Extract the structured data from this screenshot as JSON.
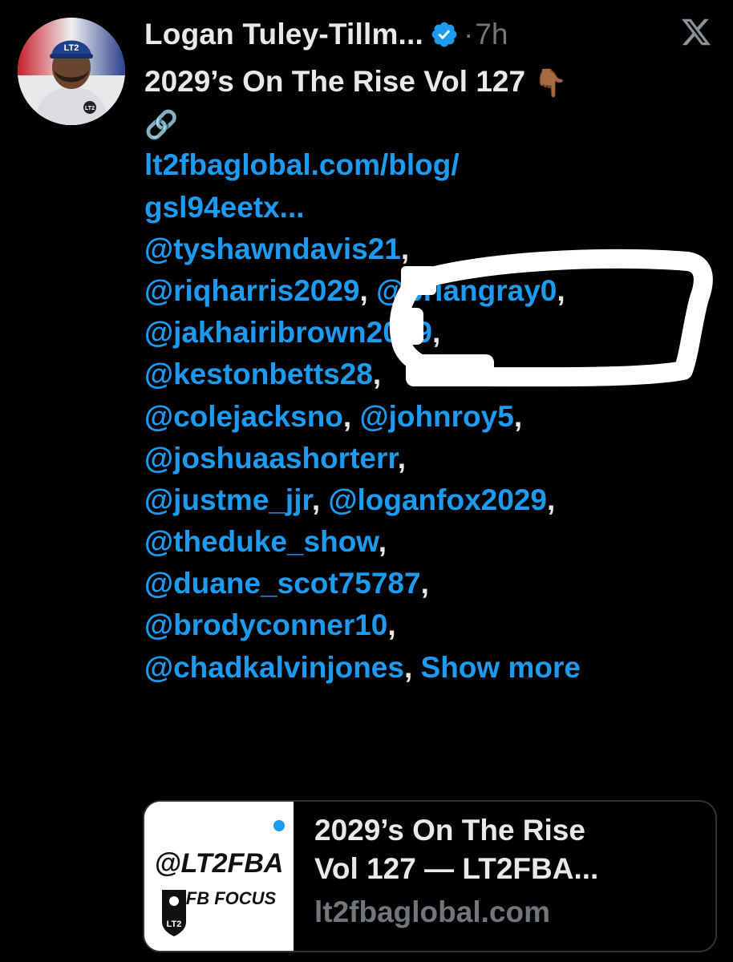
{
  "tweet": {
    "author": "Logan Tuley-Tillm...",
    "separator": "·",
    "time": "7h",
    "lines": [
      {
        "parts": [
          {
            "text": "2029’s On The Rise Vol 127 ",
            "kind": "plain"
          },
          {
            "text": "👇🏾",
            "kind": "emoji"
          }
        ]
      },
      {
        "parts": [
          {
            "text": "🔗",
            "kind": "emoji"
          }
        ]
      },
      {
        "parts": [
          {
            "text": "lt2fbaglobal.com/blog/",
            "kind": "link"
          }
        ]
      },
      {
        "parts": [
          {
            "text": "gsl94eetx...",
            "kind": "link"
          }
        ]
      },
      {
        "parts": [
          {
            "text": "@tyshawndavis21",
            "kind": "link"
          },
          {
            "text": ",",
            "kind": "plain"
          }
        ]
      },
      {
        "parts": [
          {
            "text": "@riqharris2029",
            "kind": "link"
          },
          {
            "text": ", ",
            "kind": "plain"
          },
          {
            "text": "@briangray0",
            "kind": "link"
          },
          {
            "text": ",",
            "kind": "plain"
          }
        ]
      },
      {
        "parts": [
          {
            "text": "@jakhairibrown2029",
            "kind": "link"
          },
          {
            "text": ",",
            "kind": "plain"
          }
        ]
      },
      {
        "parts": [
          {
            "text": "@kestonbetts28",
            "kind": "link"
          },
          {
            "text": ",",
            "kind": "plain"
          }
        ]
      },
      {
        "parts": [
          {
            "text": "@colejacksno",
            "kind": "link"
          },
          {
            "text": ", ",
            "kind": "plain"
          },
          {
            "text": "@johnroy5",
            "kind": "link"
          },
          {
            "text": ",",
            "kind": "plain"
          }
        ]
      },
      {
        "parts": [
          {
            "text": "@joshuaashorterr",
            "kind": "link"
          },
          {
            "text": ",",
            "kind": "plain"
          }
        ]
      },
      {
        "parts": [
          {
            "text": "@justme_jjr",
            "kind": "link"
          },
          {
            "text": ", ",
            "kind": "plain"
          },
          {
            "text": "@loganfox2029",
            "kind": "link"
          },
          {
            "text": ",",
            "kind": "plain"
          }
        ]
      },
      {
        "parts": [
          {
            "text": "@theduke_show",
            "kind": "link"
          },
          {
            "text": ",",
            "kind": "plain"
          }
        ]
      },
      {
        "parts": [
          {
            "text": "@duane_scot75787",
            "kind": "link"
          },
          {
            "text": ",",
            "kind": "plain"
          }
        ]
      },
      {
        "parts": [
          {
            "text": "@brodyconner10",
            "kind": "link"
          },
          {
            "text": ",",
            "kind": "plain"
          }
        ]
      },
      {
        "parts": [
          {
            "text": "@chadkalvinjones",
            "kind": "link"
          },
          {
            "text": ", ",
            "kind": "plain"
          },
          {
            "text": "Show more",
            "kind": "link"
          }
        ]
      }
    ]
  },
  "card": {
    "title_line1": "2029’s On The Rise",
    "title_line2": "Vol 127 — LT2FBA...",
    "domain": "lt2fbaglobal.com",
    "thumb_text1": "@LT2FBA",
    "thumb_text2": "FB FOCUS",
    "thumb_badge": "LT2"
  },
  "avatar": {
    "cap_text": "LT2",
    "shirt_text": "LT2"
  },
  "icons": {
    "verified": "verified-badge-icon",
    "x": "x-logo-icon",
    "finger": "pointing-down-emoji",
    "chain": "link-chain-emoji"
  },
  "colors": {
    "background": "#000000",
    "text": "#e7e9ea",
    "link": "#1d9bf0",
    "muted": "#71767b",
    "scribble": "#ffffff"
  }
}
